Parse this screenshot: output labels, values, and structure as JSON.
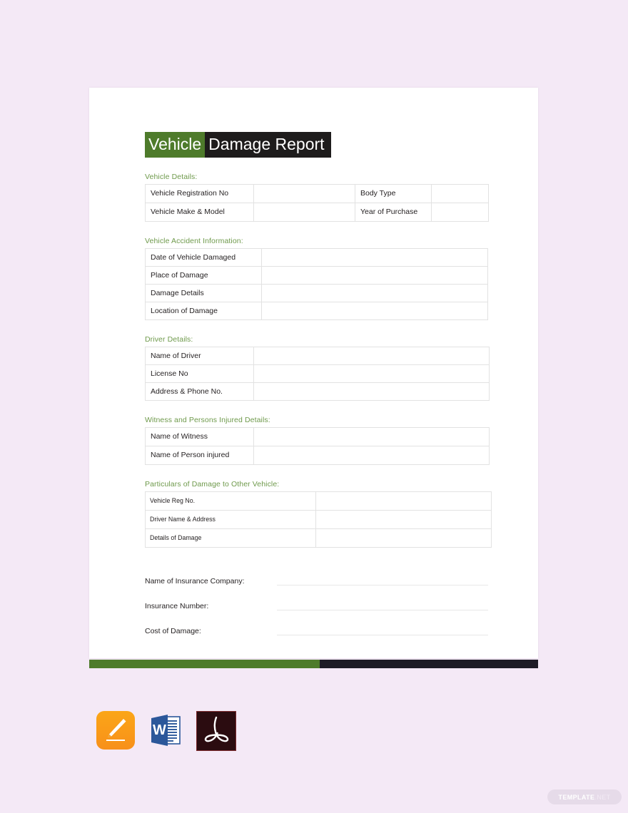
{
  "document": {
    "title": {
      "part_green": "Vehicle",
      "part_dark": "Damage Report"
    },
    "sections": [
      {
        "heading": "Vehicle Details:",
        "rows": [
          {
            "label_a": "Vehicle Registration No",
            "value_a": "",
            "label_b": "Body Type",
            "value_b": ""
          },
          {
            "label_a": "Vehicle Make & Model",
            "value_a": "",
            "label_b": "Year of Purchase",
            "value_b": ""
          }
        ]
      },
      {
        "heading": "Vehicle Accident Information:",
        "rows": [
          {
            "label": "Date of Vehicle Damaged",
            "value": ""
          },
          {
            "label": "Place of Damage",
            "value": ""
          },
          {
            "label": "Damage Details",
            "value": ""
          },
          {
            "label": "Location of Damage",
            "value": ""
          }
        ]
      },
      {
        "heading": "Driver Details:",
        "rows": [
          {
            "label": "Name of Driver",
            "value": ""
          },
          {
            "label": "License No",
            "value": ""
          },
          {
            "label": "Address & Phone No.",
            "value": ""
          }
        ]
      },
      {
        "heading": "Witness and Persons Injured Details:",
        "rows": [
          {
            "label": "Name of Witness",
            "value": ""
          },
          {
            "label": "Name of Person injured",
            "value": ""
          }
        ]
      },
      {
        "heading": "Particulars of Damage to Other Vehicle:",
        "rows": [
          {
            "label": "Vehicle Reg No.",
            "value": ""
          },
          {
            "label": "Driver Name & Address",
            "value": ""
          },
          {
            "label": "Details of Damage",
            "value": ""
          }
        ]
      }
    ],
    "fields": [
      {
        "label": "Name of Insurance Company:",
        "value": ""
      },
      {
        "label": "Insurance Number:",
        "value": ""
      },
      {
        "label": "Cost of Damage:",
        "value": ""
      }
    ]
  },
  "format_icons": [
    {
      "name": "apple-pages-icon",
      "label": "Apple Pages"
    },
    {
      "name": "microsoft-word-icon",
      "label": "Microsoft Word"
    },
    {
      "name": "adobe-pdf-icon",
      "label": "PDF"
    }
  ],
  "watermark": {
    "primary": "TEMPLATE",
    "secondary": ".NET"
  },
  "colors": {
    "accent_green": "#4e7b2b",
    "heading_green": "#6f9a4c",
    "title_dark": "#1e1c1c",
    "footer_dark": "#1e1c26",
    "page_background": "#f4e9f6",
    "table_border": "#e2e2e2"
  }
}
